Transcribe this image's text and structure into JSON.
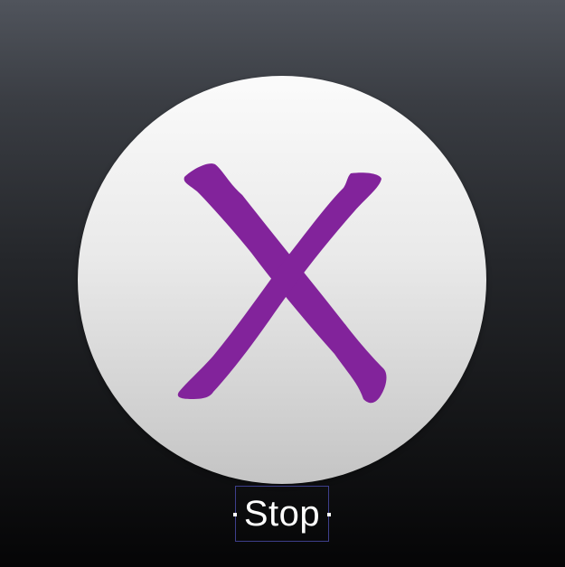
{
  "button": {
    "label": "Stop",
    "icon": "close-x-icon"
  },
  "colors": {
    "accent": "#82239b",
    "circle_top": "#fbfbfb",
    "circle_bottom": "#c4c4c4",
    "background_top": "#50545c",
    "background_bottom": "#050506",
    "selection_outline": "#3e3f8c",
    "label_text": "#ffffff"
  }
}
